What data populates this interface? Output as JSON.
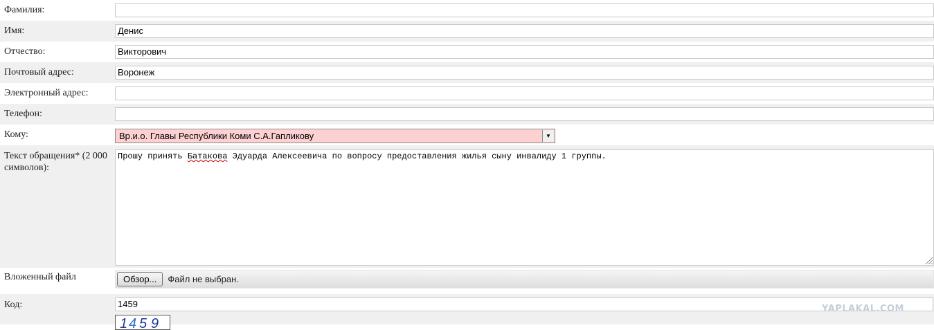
{
  "form": {
    "fields": [
      {
        "label": "Фамилия:",
        "value": ""
      },
      {
        "label": "Имя:",
        "value": "Денис"
      },
      {
        "label": "Отчество:",
        "value": "Викторович"
      },
      {
        "label": "Почтовый адрес:",
        "value": "Воронеж"
      },
      {
        "label": "Электронный адрес:",
        "value": ""
      },
      {
        "label": "Телефон:",
        "value": ""
      }
    ],
    "recipient": {
      "label": "Кому:",
      "selected": "Вр.и.о. Главы Республики Коми С.А.Гапликову"
    },
    "message": {
      "label": "Текст обращения* (2 000 символов):",
      "text_before": "Прошу принять ",
      "text_misspelled": "Батакова",
      "text_after": " Эдуарда Алексеевича по вопросу предоставления жилья сыну инвалиду 1 группы."
    },
    "attachment": {
      "label": "Вложенный файл",
      "browse_label": "Обзор...",
      "status": "Файл не выбран."
    },
    "code": {
      "label": "Код:",
      "value": "1459"
    }
  },
  "watermark": "YAPLAKAL.COM",
  "colors": {
    "alt_row": "#f0f0f0",
    "select_bg": "#fdd1d1",
    "captcha_digits": "#1a3a9c"
  }
}
